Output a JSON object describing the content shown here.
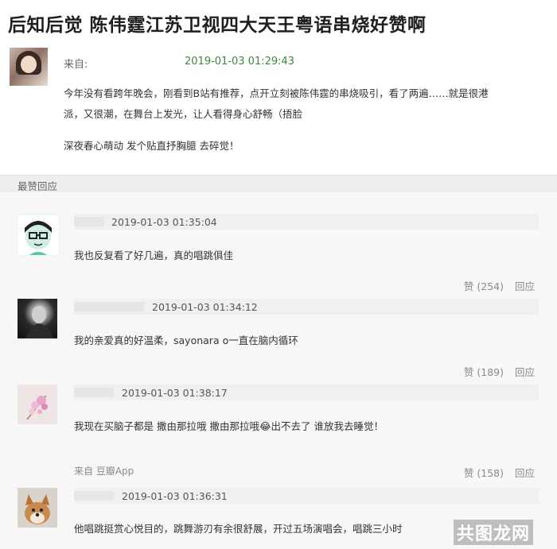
{
  "title": "后知后觉 陈伟霆江苏卫视四大天王粤语串烧好赞啊",
  "post": {
    "from_label": "来自:",
    "time": "2019-01-03 01:29:43",
    "paragraph1_line1": "今年没有看跨年晚会，刚看到B站有推荐，点开立刻被陈伟霆的串烧吸引，看了两遍……就是很港",
    "paragraph1_line2": "派，又很潮，在舞台上发光，让人看得身心舒畅（捂脸",
    "paragraph2": "深夜春心萌动 发个贴直抒胸臆 去碎觉！"
  },
  "section_header": "最赞回应",
  "comments": [
    {
      "time": "2019-01-03 01:35:04",
      "text": "我也反复看了好几遍，真的唱跳俱佳",
      "like": "赞 (254)",
      "reply": "回应"
    },
    {
      "time": "2019-01-03 01:34:12",
      "text": "我的亲爱真的好温柔，sayonara o一直在脑内循环",
      "like": "赞 (189)",
      "reply": "回应"
    },
    {
      "time": "2019-01-03 01:38:17",
      "text": "我现在买脑子都是 撒由那拉哦 撒由那拉哦😂出不去了 谁放我去睡觉！",
      "source": "来自 豆瓣App",
      "like": "赞 (158)",
      "reply": "回应"
    },
    {
      "time": "2019-01-03 01:36:31",
      "text": "他唱跳挺赏心悦目的，跳舞游刃有余很舒展，开过五场演唱会，唱跳三小时"
    }
  ],
  "watermark": "共图龙网"
}
